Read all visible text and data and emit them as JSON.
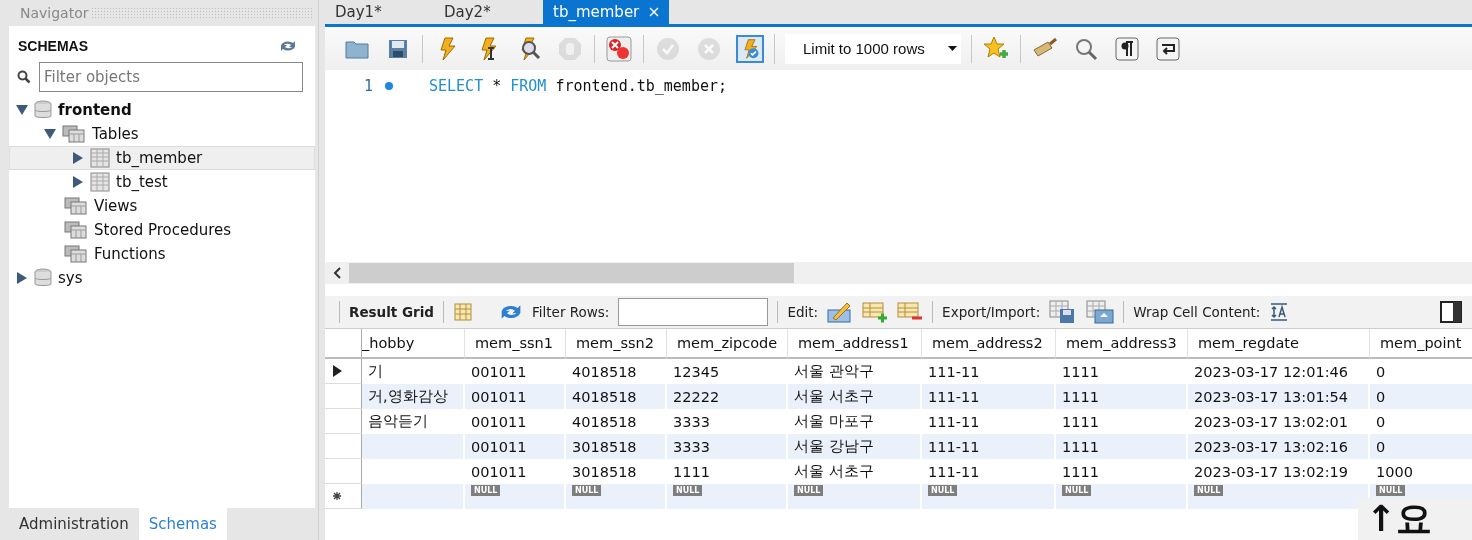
{
  "navigator": {
    "title": "Navigator",
    "heading": "SCHEMAS",
    "filter": {
      "placeholder": "Filter objects"
    },
    "tree": [
      {
        "label": "frontend",
        "kind": "schema",
        "expanded": true,
        "selected": false,
        "children": [
          {
            "label": "Tables",
            "kind": "group",
            "expanded": true,
            "selected": false,
            "children": [
              {
                "label": "tb_member",
                "kind": "table",
                "expanded": false,
                "selected": true
              },
              {
                "label": "tb_test",
                "kind": "table",
                "expanded": false,
                "selected": false
              }
            ]
          },
          {
            "label": "Views",
            "kind": "group",
            "selected": false
          },
          {
            "label": "Stored Procedures",
            "kind": "group",
            "selected": false
          },
          {
            "label": "Functions",
            "kind": "group",
            "selected": false
          }
        ]
      },
      {
        "label": "sys",
        "kind": "schema",
        "expanded": false,
        "selected": false
      }
    ],
    "bottom_tabs": [
      {
        "label": "Administration",
        "selected": false
      },
      {
        "label": "Schemas",
        "selected": true
      }
    ]
  },
  "editor_tabs": [
    {
      "label": "Day1*",
      "selected": false
    },
    {
      "label": "Day2*",
      "selected": false
    },
    {
      "label": "tb_member",
      "selected": true
    }
  ],
  "toolbar_groups": [
    {
      "items": [
        {
          "kind": "open",
          "disabled": false,
          "pressed": false
        },
        {
          "kind": "save",
          "disabled": false,
          "pressed": false
        }
      ]
    },
    {
      "items": [
        {
          "kind": "execute",
          "disabled": false,
          "pressed": false
        },
        {
          "kind": "execute-current",
          "disabled": false,
          "pressed": false
        },
        {
          "kind": "explain",
          "disabled": false,
          "pressed": false
        },
        {
          "kind": "stop",
          "disabled": true,
          "pressed": false
        }
      ]
    },
    {
      "items": [
        {
          "kind": "stop-on-error",
          "disabled": false,
          "pressed": false
        }
      ]
    },
    {
      "items": [
        {
          "kind": "commit",
          "disabled": true,
          "pressed": false
        },
        {
          "kind": "rollback",
          "disabled": true,
          "pressed": false
        },
        {
          "kind": "autocommit",
          "disabled": false,
          "pressed": true
        }
      ]
    },
    {
      "items": [
        {
          "kind": "limit",
          "value": "Limit to 1000 rows"
        }
      ]
    },
    {
      "items": [
        {
          "kind": "snippet",
          "disabled": false,
          "pressed": false
        }
      ]
    },
    {
      "items": [
        {
          "kind": "beautify",
          "disabled": false,
          "pressed": false
        },
        {
          "kind": "find",
          "disabled": false,
          "pressed": false
        },
        {
          "kind": "invisibles",
          "disabled": false,
          "pressed": false
        },
        {
          "kind": "wrap",
          "disabled": false,
          "pressed": false
        }
      ]
    }
  ],
  "editor": {
    "lines": [
      {
        "number": "1",
        "marker": true,
        "tokens": [
          {
            "text": "SELECT",
            "kind": "keyword"
          },
          {
            "text": " * ",
            "kind": "plain"
          },
          {
            "text": "FROM",
            "kind": "keyword"
          },
          {
            "text": " frontend.tb_member;",
            "kind": "plain"
          }
        ]
      }
    ]
  },
  "result_toolbar": {
    "title": "Result Grid",
    "filter_label": "Filter Rows:",
    "edit_label": "Edit:",
    "export_label": "Export/Import:",
    "wrap_label": "Wrap Cell Content:"
  },
  "grid": {
    "columns": [
      "_hobby",
      "mem_ssn1",
      "mem_ssn2",
      "mem_zipcode",
      "mem_address1",
      "mem_address2",
      "mem_address3",
      "mem_regdate",
      "mem_point"
    ],
    "rows": [
      {
        "kind": "data",
        "current": true,
        "cells": [
          "기",
          "001011",
          "4018518",
          "12345",
          "서울 관악구",
          "111-11",
          "1111",
          "2023-03-17 12:01:46",
          "0"
        ]
      },
      {
        "kind": "data",
        "current": false,
        "cells": [
          "거,영화감상",
          "001011",
          "4018518",
          "22222",
          "서울 서초구",
          "111-11",
          "1111",
          "2023-03-17 13:01:54",
          "0"
        ]
      },
      {
        "kind": "data",
        "current": false,
        "cells": [
          "음악듣기",
          "001011",
          "4018518",
          "3333",
          "서울 마포구",
          "111-11",
          "1111",
          "2023-03-17 13:02:01",
          "0"
        ]
      },
      {
        "kind": "data",
        "current": false,
        "cells": [
          null,
          "001011",
          "3018518",
          "3333",
          "서울 강남구",
          "111-11",
          "1111",
          "2023-03-17 13:02:16",
          "0"
        ]
      },
      {
        "kind": "data",
        "current": false,
        "cells": [
          null,
          "001011",
          "3018518",
          "1111",
          "서울 서초구",
          "111-11",
          "1111",
          "2023-03-17 13:02:19",
          "1000"
        ]
      },
      {
        "kind": "new",
        "current": false,
        "cells": [
          null,
          "NULL",
          "NULL",
          "NULL",
          "NULL",
          "NULL",
          "NULL",
          "NULL",
          "NULL"
        ]
      }
    ]
  },
  "overlay": {
    "caption": "↑요"
  }
}
